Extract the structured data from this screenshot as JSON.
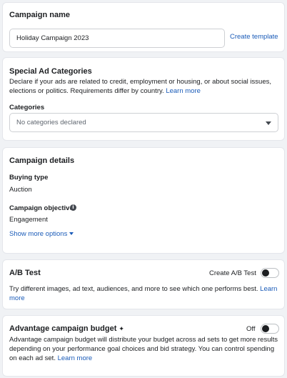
{
  "campaign_name": {
    "title": "Campaign name",
    "input_value": "Holiday Campaign 2023",
    "create_template_label": "Create template"
  },
  "special_ad": {
    "title": "Special Ad Categories",
    "description": "Declare if your ads are related to credit, employment or housing, or about social issues, elections or politics. Requirements differ by country.",
    "learn_more": "Learn more",
    "categories_label": "Categories",
    "categories_value": "No categories declared"
  },
  "details": {
    "title": "Campaign details",
    "buying_type_label": "Buying type",
    "buying_type_value": "Auction",
    "objective_label": "Campaign objective",
    "objective_value": "Engagement",
    "show_more": "Show more options"
  },
  "ab_test": {
    "title": "A/B Test",
    "toggle_label": "Create A/B Test",
    "description": "Try different images, ad text, audiences, and more to see which one performs best.",
    "learn_more": "Learn more",
    "toggle_on": false
  },
  "budget": {
    "title": "Advantage campaign budget",
    "title_icon": "✦",
    "toggle_label": "Off",
    "description": "Advantage campaign budget will distribute your budget across ad sets to get more results depending on your performance goal choices and bid strategy. You can control spending on each ad set.",
    "learn_more": "Learn more",
    "toggle_on": false
  }
}
